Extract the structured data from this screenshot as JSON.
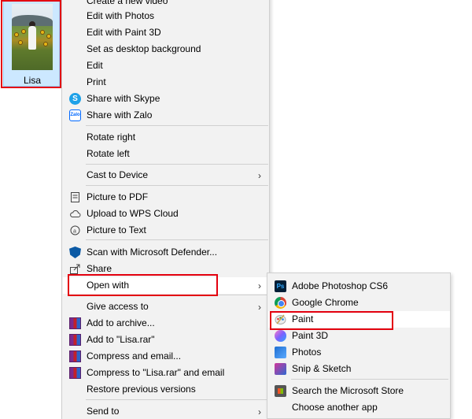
{
  "file": {
    "name": "Lisa"
  },
  "context_menu": {
    "items": [
      {
        "label": "Create a new video"
      },
      {
        "label": "Edit with Photos"
      },
      {
        "label": "Edit with Paint 3D"
      },
      {
        "label": "Set as desktop background"
      },
      {
        "label": "Edit"
      },
      {
        "label": "Print"
      },
      {
        "label": "Share with Skype",
        "icon": "skype-icon"
      },
      {
        "label": "Share with Zalo",
        "icon": "zalo-icon"
      },
      {
        "label": "Rotate right"
      },
      {
        "label": "Rotate left"
      },
      {
        "label": "Cast to Device",
        "submenu": true
      },
      {
        "label": "Picture to PDF",
        "icon": "pdf-icon"
      },
      {
        "label": "Upload to WPS Cloud",
        "icon": "cloud-icon"
      },
      {
        "label": "Picture to Text",
        "icon": "text-recognition-icon"
      },
      {
        "label": "Scan with Microsoft Defender...",
        "icon": "defender-shield-icon"
      },
      {
        "label": "Share",
        "icon": "share-icon"
      },
      {
        "label": "Open with",
        "submenu": true
      },
      {
        "label": "Give access to",
        "submenu": true
      },
      {
        "label": "Add to archive...",
        "icon": "winrar-icon"
      },
      {
        "label": "Add to \"Lisa.rar\"",
        "icon": "winrar-icon"
      },
      {
        "label": "Compress and email...",
        "icon": "winrar-icon"
      },
      {
        "label": "Compress to \"Lisa.rar\" and email",
        "icon": "winrar-icon"
      },
      {
        "label": "Restore previous versions"
      },
      {
        "label": "Send to",
        "submenu": true
      }
    ],
    "submenu_arrow": "›"
  },
  "open_with_submenu": {
    "items": [
      {
        "label": "Adobe Photoshop CS6",
        "icon": "photoshop-icon",
        "icon_text": "Ps"
      },
      {
        "label": "Google Chrome",
        "icon": "chrome-icon"
      },
      {
        "label": "Paint",
        "icon": "paint-icon"
      },
      {
        "label": "Paint 3D",
        "icon": "paint-3d-icon"
      },
      {
        "label": "Photos",
        "icon": "photos-icon"
      },
      {
        "label": "Snip & Sketch",
        "icon": "snip-sketch-icon"
      },
      {
        "label": "Search the Microsoft Store",
        "icon": "microsoft-store-icon"
      },
      {
        "label": "Choose another app"
      }
    ]
  },
  "colors": {
    "highlight_box": "#e3000f",
    "menu_bg": "#f2f2f2",
    "selection_bg": "#cce8ff"
  }
}
